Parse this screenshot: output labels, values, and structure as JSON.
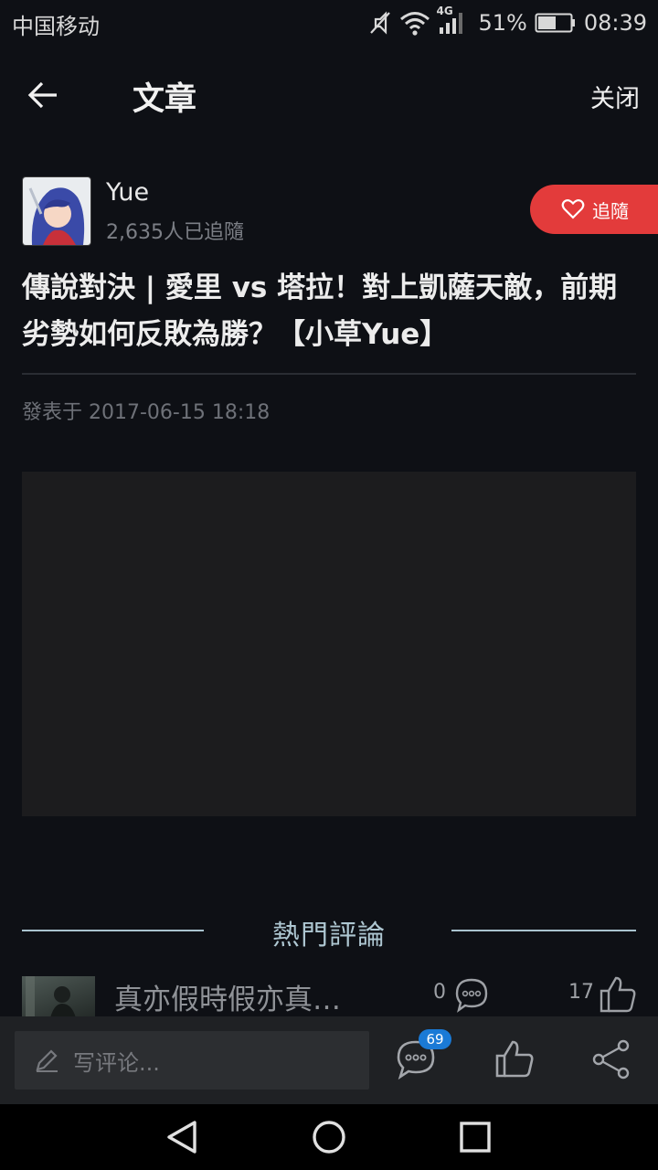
{
  "status_bar": {
    "carrier": "中国移动",
    "network": "4G",
    "battery": "51%",
    "time": "08:39"
  },
  "nav": {
    "title": "文章",
    "close_label": "关闭"
  },
  "author": {
    "name": "Yue",
    "followers": "2,635人已追隨",
    "follow_label": "追隨"
  },
  "article": {
    "title": "傳說對決 | 愛里 vs 塔拉！對上凱薩天敵，前期劣勢如何反敗為勝？【小草Yue】",
    "published": "發表于 2017-06-15 18:18"
  },
  "hot_comments": {
    "heading": "熱門評論",
    "items": [
      {
        "text": "真亦假時假亦真…",
        "reply_count": "0",
        "like_count": "17"
      }
    ]
  },
  "toolbar": {
    "comment_placeholder": "写评论...",
    "comment_badge": "69"
  },
  "colors": {
    "background": "#0e1015",
    "accent_red": "#e33b3b",
    "badge_blue": "#1a7ad6",
    "hot_heading": "#aec7d2"
  }
}
